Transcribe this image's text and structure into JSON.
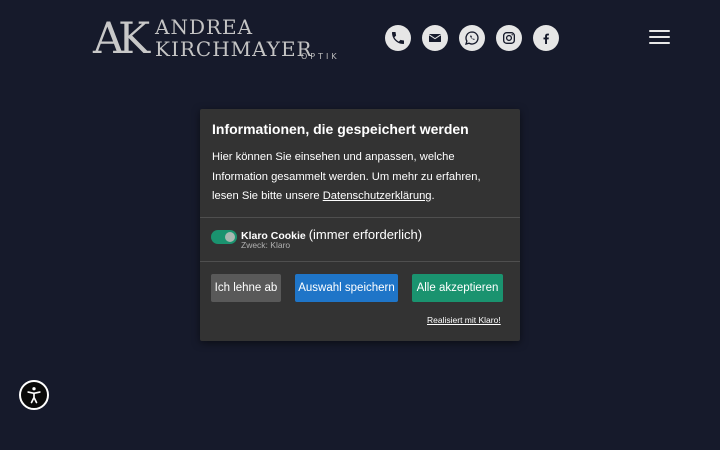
{
  "header": {
    "logo": {
      "monogram": "AK",
      "line1": "ANDREA",
      "line2": "KIRCHMAYER",
      "sub": "OPTIK"
    },
    "social_icons": [
      "phone-icon",
      "mail-icon",
      "whatsapp-icon",
      "instagram-icon",
      "facebook-icon"
    ],
    "menu_icon": "hamburger-menu-icon"
  },
  "consent": {
    "title": "Informationen, die gespeichert werden",
    "description_before": "Hier können Sie einsehen und anpassen, welche Information gesammelt werden. Um mehr zu erfahren, lesen Sie bitte unsere ",
    "privacy_link": "Datenschutzerklärung",
    "description_after": ".",
    "service": {
      "name": "Klaro Cookie",
      "required_label": "(immer erforderlich)",
      "purpose": "Zweck: Klaro",
      "enabled": true
    },
    "buttons": {
      "decline": "Ich lehne ab",
      "save": "Auswahl speichern",
      "accept_all": "Alle akzeptieren"
    },
    "powered_by": "Realisiert mit Klaro!"
  },
  "accessibility_button": "accessibility-icon",
  "colors": {
    "background": "#161a2b",
    "modal": "#333333",
    "decline": "#595959",
    "save": "#1f75c8",
    "accept": "#1a936f"
  }
}
